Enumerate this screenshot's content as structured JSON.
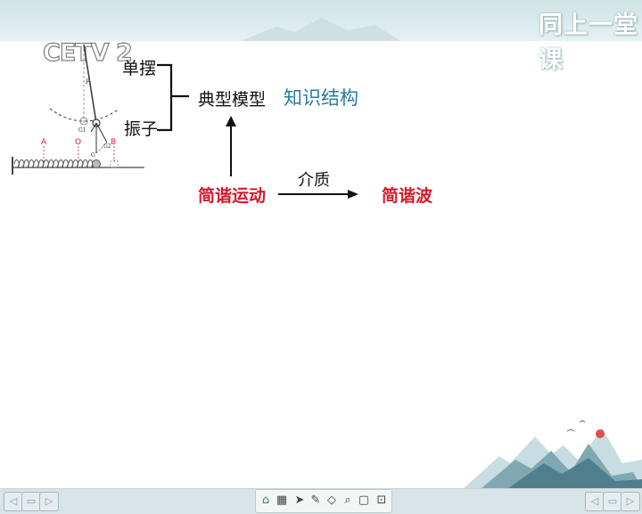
{
  "brand": {
    "logo": "同上一堂课",
    "logo_small": "同上一堂课"
  },
  "watermark": {
    "text": "CETV 2"
  },
  "diagram_labels": {
    "A": "A",
    "O": "O",
    "B": "B",
    "F": "F",
    "G1": "G1",
    "G2": "G2",
    "G": "G"
  },
  "map": {
    "danbai": "单摆",
    "zhenzi": "振子",
    "model": "典型模型",
    "title": "知识结构",
    "shm": "简谐运动",
    "medium": "介质",
    "wave": "简谐波"
  },
  "toolbar": {
    "tools": [
      "home-icon",
      "grid-icon",
      "cursor-icon",
      "pen-icon",
      "eraser-icon",
      "search-icon",
      "whiteboard-icon",
      "screen-icon"
    ]
  },
  "colors": {
    "accent_red": "#d8182b",
    "title_blue": "#2a7aa3",
    "header": "#cfe3e6"
  }
}
